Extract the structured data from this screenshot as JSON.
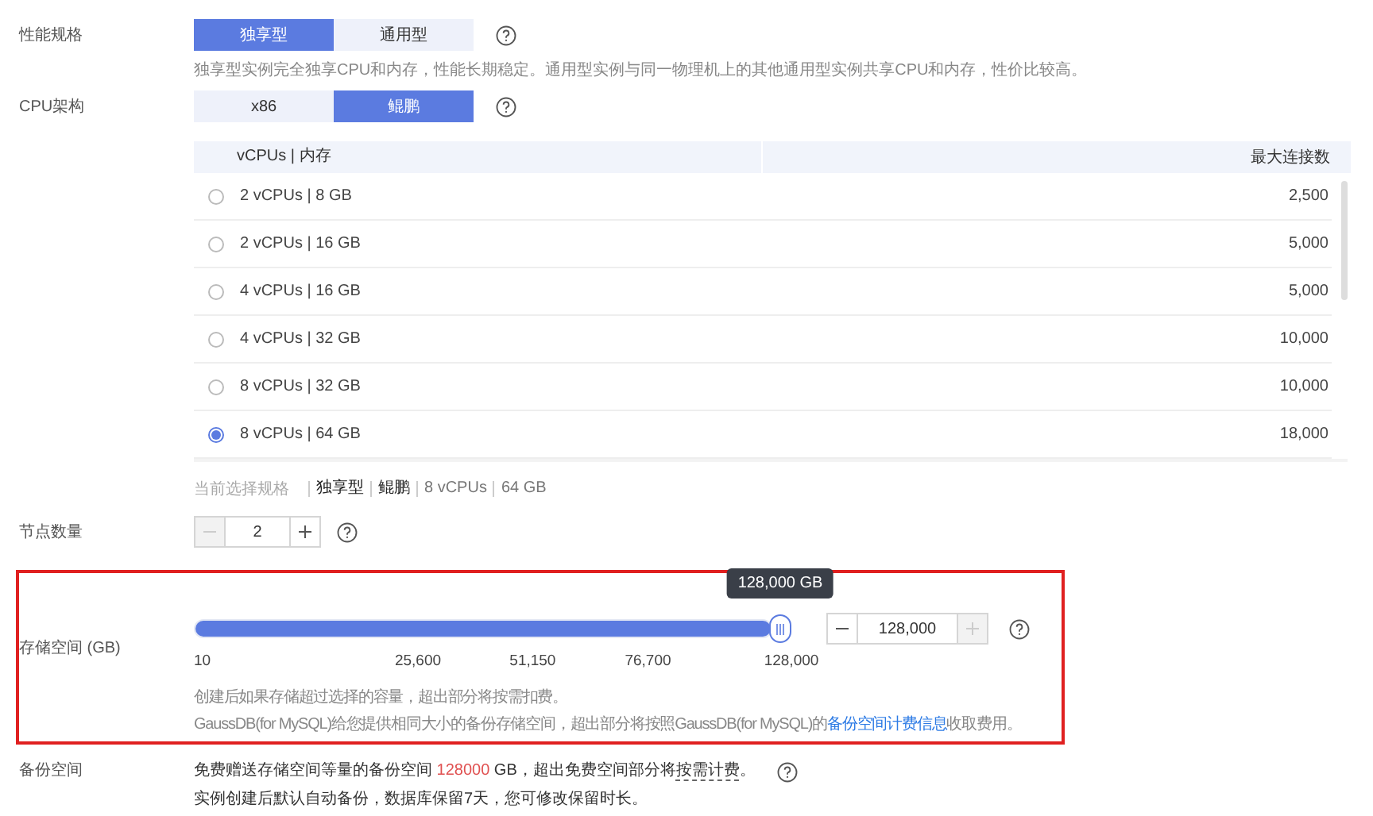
{
  "performance": {
    "label": "性能规格",
    "options": [
      {
        "label": "独享型",
        "selected": true
      },
      {
        "label": "通用型",
        "selected": false
      }
    ],
    "description": "独享型实例完全独享CPU和内存，性能长期稳定。通用型实例与同一物理机上的其他通用型实例共享CPU和内存，性价比较高。"
  },
  "cpu_arch": {
    "label": "CPU架构",
    "options": [
      {
        "label": "x86",
        "selected": false
      },
      {
        "label": "鲲鹏",
        "selected": true
      }
    ]
  },
  "spec_table": {
    "columns": [
      "vCPUs | 内存",
      "最大连接数"
    ],
    "rows": [
      {
        "spec": "2 vCPUs | 8 GB",
        "max_connections": "2,500",
        "selected": false
      },
      {
        "spec": "2 vCPUs | 16 GB",
        "max_connections": "5,000",
        "selected": false
      },
      {
        "spec": "4 vCPUs | 16 GB",
        "max_connections": "5,000",
        "selected": false
      },
      {
        "spec": "4 vCPUs | 32 GB",
        "max_connections": "10,000",
        "selected": false
      },
      {
        "spec": "8 vCPUs | 32 GB",
        "max_connections": "10,000",
        "selected": false
      },
      {
        "spec": "8 vCPUs | 64 GB",
        "max_connections": "18,000",
        "selected": true
      }
    ]
  },
  "current_spec": {
    "label": "当前选择规格",
    "items": [
      {
        "text": "独享型",
        "kind": "strong"
      },
      {
        "text": "鲲鹏",
        "kind": "strong"
      },
      {
        "text": "8 vCPUs",
        "kind": "plain"
      },
      {
        "text": "64 GB",
        "kind": "plain"
      }
    ]
  },
  "node_count": {
    "label": "节点数量",
    "value": "2",
    "minus_disabled": true,
    "plus_disabled": false
  },
  "storage": {
    "label": "存储空间 (GB)",
    "highlighted": true,
    "level": 1,
    "tooltip": "128,000 GB",
    "ticks": [
      "10",
      "25,600",
      "51,150",
      "76,700",
      "128,000"
    ],
    "value": "128,000",
    "minus_disabled": false,
    "plus_disabled": true,
    "notes": [
      {
        "parts": [
          {
            "text": "创建后如果存储超过选择的容量，超出部分将按需扣费。",
            "kind": "plain"
          }
        ]
      },
      {
        "parts": [
          {
            "text": "GaussDB(for MySQL)给您提供相同大小的备份存储空间，超出部分将按照GaussDB(for MySQL)的",
            "kind": "plain"
          },
          {
            "text": "备份空间计费信息",
            "kind": "link"
          },
          {
            "text": "收取费用。",
            "kind": "plain"
          }
        ]
      }
    ]
  },
  "backup": {
    "label": "备份空间",
    "lines": [
      {
        "parts": [
          {
            "text": "免费赠送存储空间等量的备份空间 ",
            "kind": "plain"
          },
          {
            "text": "128000",
            "kind": "highlight"
          },
          {
            "text": " GB，超出免费空间部分将",
            "kind": "plain"
          },
          {
            "text": "按需计费",
            "kind": "link"
          },
          {
            "text": "。",
            "kind": "plain"
          }
        ]
      },
      {
        "parts": [
          {
            "text": "实例创建后默认自动备份，数据库保留7天，您可修改保留时长。",
            "kind": "plain"
          }
        ]
      }
    ]
  }
}
